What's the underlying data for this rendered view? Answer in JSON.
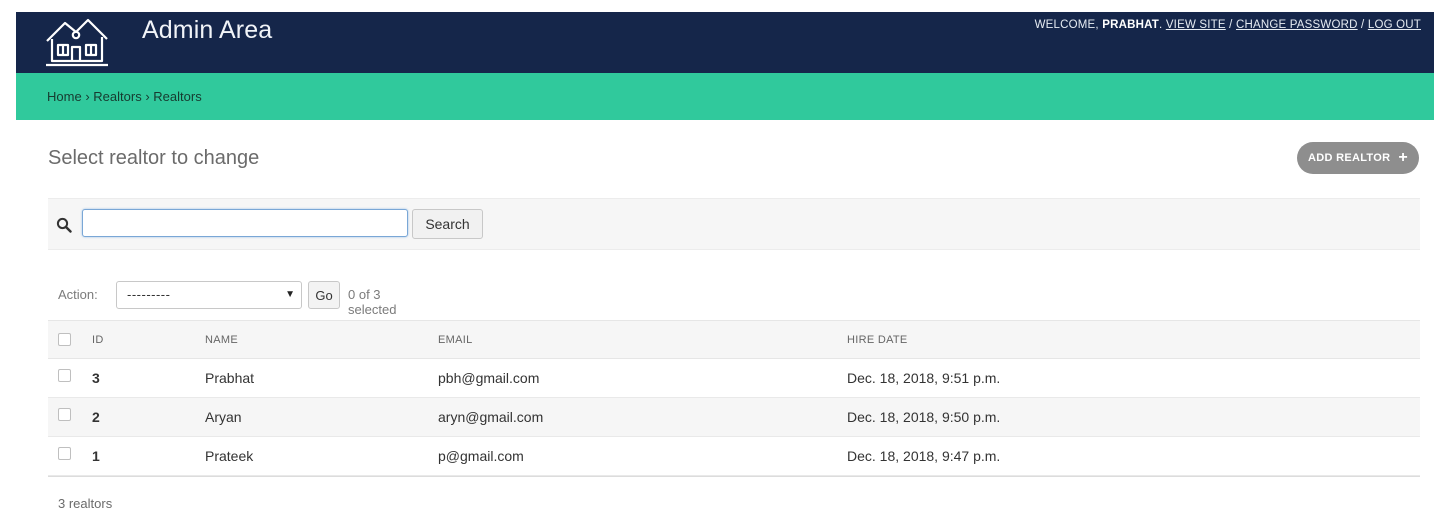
{
  "header": {
    "brand": "Admin Area",
    "welcome_prefix": "WELCOME,",
    "username": "PRABHAT",
    "welcome_suffix": ".",
    "view_site": "VIEW SITE",
    "sep": "/",
    "change_password": "CHANGE PASSWORD",
    "log_out": "LOG OUT",
    "logo_icon": "house-logo-icon"
  },
  "breadcrumbs": {
    "home": "Home",
    "sep": "›",
    "app": "Realtors",
    "current": "Realtors"
  },
  "page": {
    "title": "Select realtor to change",
    "add_button": "ADD REALTOR",
    "add_icon": "+"
  },
  "search": {
    "value": "",
    "placeholder": "",
    "button": "Search",
    "icon": "search-icon"
  },
  "actions": {
    "label": "Action:",
    "selected_option": "---------",
    "caret": "▼",
    "go": "Go",
    "counter": "0 of 3 selected"
  },
  "table": {
    "headers": [
      "ID",
      "NAME",
      "EMAIL",
      "HIRE DATE"
    ],
    "rows": [
      {
        "id": "3",
        "name": "Prabhat",
        "email": "pbh@gmail.com",
        "hire_date": "Dec. 18, 2018, 9:51 p.m."
      },
      {
        "id": "2",
        "name": "Aryan",
        "email": "aryn@gmail.com",
        "hire_date": "Dec. 18, 2018, 9:50 p.m."
      },
      {
        "id": "1",
        "name": "Prateek",
        "email": "p@gmail.com",
        "hire_date": "Dec. 18, 2018, 9:47 p.m."
      }
    ]
  },
  "paginator": "3 realtors",
  "colors": {
    "header_bg": "#15264a",
    "breadcrumb_bg": "#30c99c",
    "add_button_bg": "#8e8e8e"
  }
}
